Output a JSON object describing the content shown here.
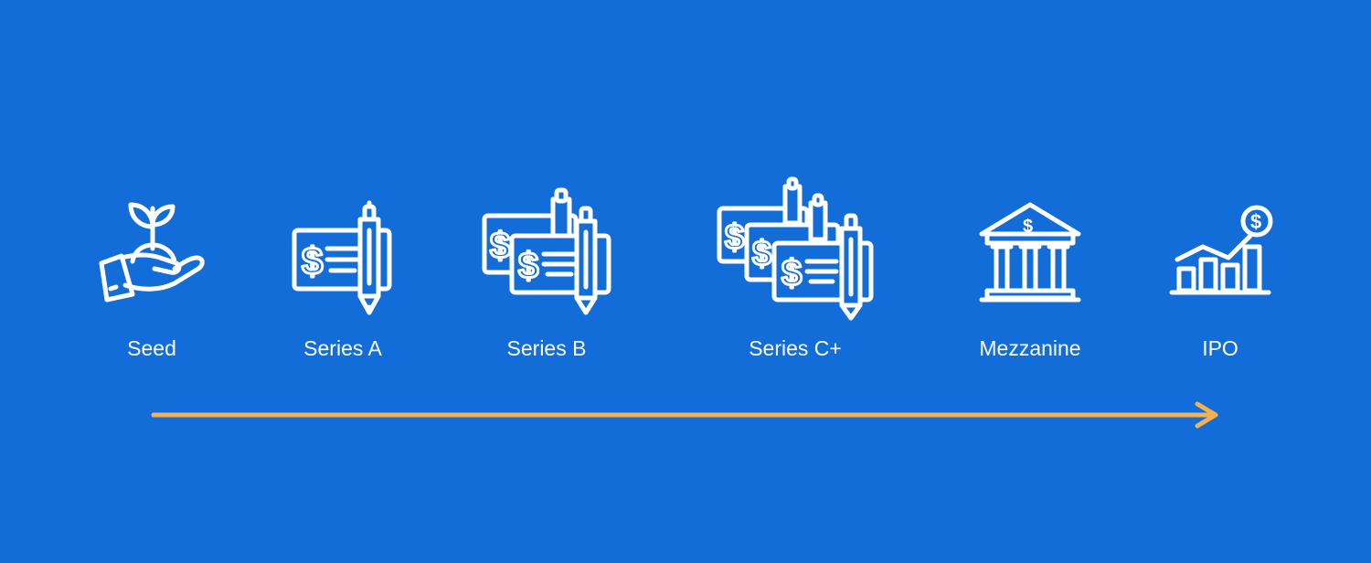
{
  "colors": {
    "background": "#136dd8",
    "icon_stroke": "#ffffff",
    "label_text": "#ffffff",
    "arrow": "#f5b04f"
  },
  "stages": [
    {
      "label": "Seed",
      "icon": "hand-sprout-icon"
    },
    {
      "label": "Series A",
      "icon": "single-check-pen-icon"
    },
    {
      "label": "Series B",
      "icon": "double-check-pen-icon"
    },
    {
      "label": "Series C+",
      "icon": "triple-check-pen-icon"
    },
    {
      "label": "Mezzanine",
      "icon": "bank-building-icon"
    },
    {
      "label": "IPO",
      "icon": "growth-chart-dollar-icon"
    }
  ]
}
